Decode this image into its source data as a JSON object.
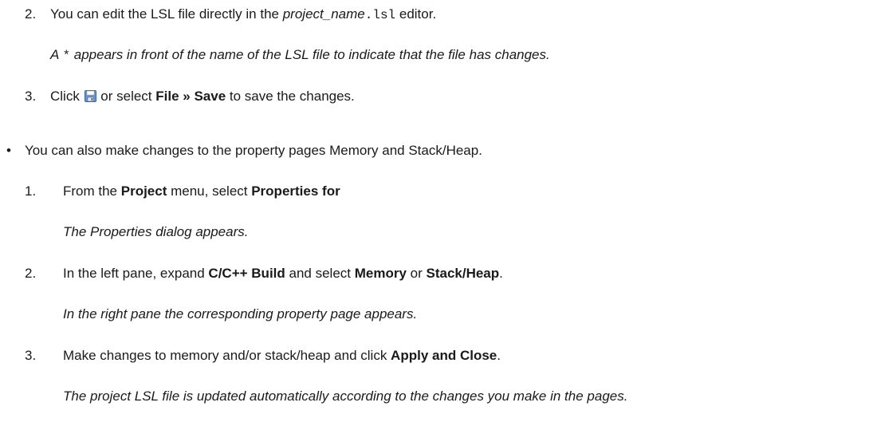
{
  "step_a2": {
    "number": "2.",
    "text_1": "You can edit the LSL file directly in the ",
    "italic_name": "project_name",
    "mono_ext": ".lsl",
    "text_2": " editor.",
    "note_1": "A ",
    "note_mono": "*",
    "note_2": " appears in front of the name of the LSL file to indicate that the file has changes."
  },
  "step_a3": {
    "number": "3.",
    "text_1": "Click ",
    "text_2": " or select ",
    "bold_1": "File",
    "sep": " » ",
    "bold_2": "Save",
    "text_3": " to save the changes.",
    "icon": "save-disk-icon"
  },
  "bullet_b": {
    "glyph": "•",
    "text": "You can also make changes to the property pages Memory and Stack/Heap."
  },
  "step_b1": {
    "number": "1.",
    "text_1": "From the ",
    "bold_1": "Project",
    "text_2": " menu, select ",
    "bold_2": "Properties for",
    "note": "The Properties dialog appears."
  },
  "step_b2": {
    "number": "2.",
    "text_1": "In the left pane, expand ",
    "bold_1": "C/C++ Build",
    "text_2": " and select ",
    "bold_2": "Memory",
    "text_3": " or ",
    "bold_3": "Stack/Heap",
    "text_4": ".",
    "note": "In the right pane the corresponding property page appears."
  },
  "step_b3": {
    "number": "3.",
    "text_1": "Make changes to memory and/or stack/heap and click ",
    "bold_1": "Apply and Close",
    "text_2": ".",
    "note": "The project LSL file is updated automatically according to the changes you make in the pages."
  }
}
